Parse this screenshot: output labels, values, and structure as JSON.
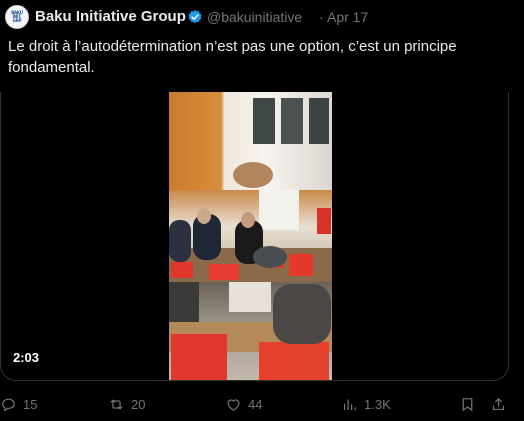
{
  "post": {
    "author_name": "Baku Initiative Group",
    "handle": "@bakuinitiative",
    "separator": "·",
    "date": "Apr 17",
    "text": "Le droit à l’autodétermination n’est pas une option, c’est un principe fondamental.",
    "avatar_text": "BAKU INITIATIVE GROUP",
    "verified_color": "#1d9bf0",
    "verified_icon": "verified-badge-icon"
  },
  "media": {
    "duration": "2:03"
  },
  "actions": {
    "replies": "15",
    "reposts": "20",
    "likes": "44",
    "views": "1.3K",
    "icons": [
      "reply-icon",
      "repost-icon",
      "like-icon",
      "views-icon",
      "bookmark-icon",
      "share-icon"
    ]
  }
}
